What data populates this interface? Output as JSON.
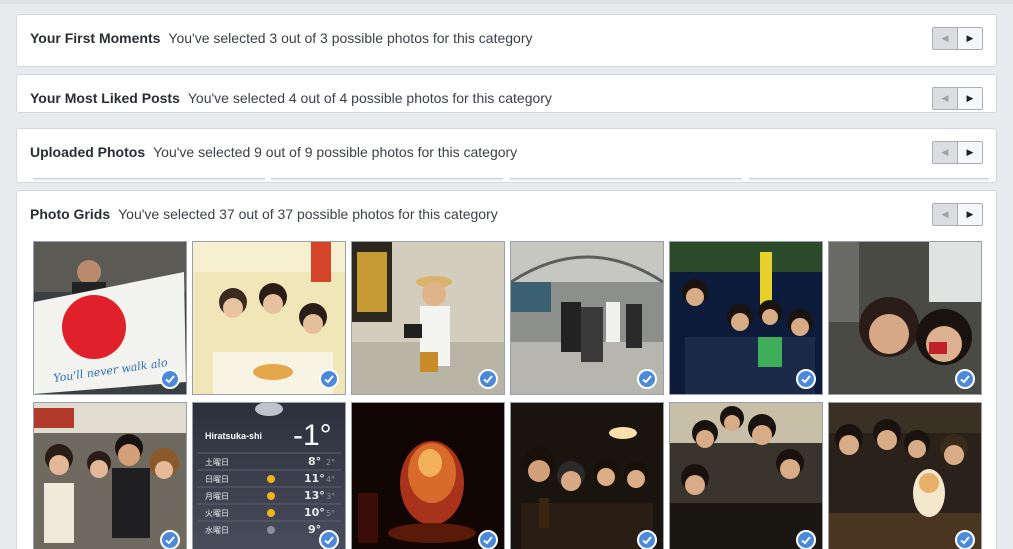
{
  "categories": [
    {
      "title": "Your First Moments",
      "desc": "You've selected 3 out of 3 possible photos for this category"
    },
    {
      "title": "Your Most Liked Posts",
      "desc": "You've selected 4 out of 4 possible photos for this category"
    },
    {
      "title": "Uploaded Photos",
      "desc": "You've selected 9 out of 9 possible photos for this category"
    },
    {
      "title": "Photo Grids",
      "desc": "You've selected 37 out of 37 possible photos for this category"
    }
  ],
  "nav": {
    "prev_icon": "triangle-left-icon",
    "next_icon": "triangle-right-icon"
  },
  "colors": {
    "check": "#4a89dc",
    "page_bg": "#e9eaed",
    "panel_border": "#d3d6db"
  },
  "flag_text": "You'll never walk alo",
  "weather": {
    "city": "Hiratsuka-shi",
    "temp": "-1°",
    "days": [
      {
        "day": "土曜日",
        "hi": "8°",
        "lo": "2°"
      },
      {
        "day": "日曜日",
        "hi": "11°",
        "lo": "4°"
      },
      {
        "day": "月曜日",
        "hi": "13°",
        "lo": "3°"
      },
      {
        "day": "火曜日",
        "hi": "10°",
        "lo": "5°"
      },
      {
        "day": "水曜日",
        "hi": "9°",
        "lo": ""
      }
    ]
  }
}
